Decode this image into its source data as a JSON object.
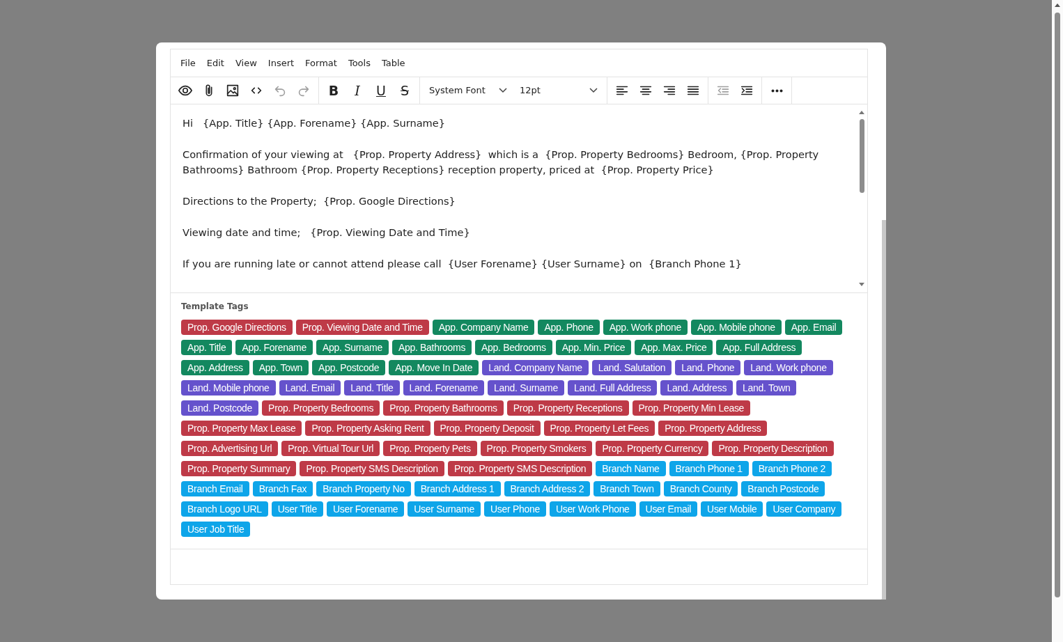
{
  "menu": [
    "File",
    "Edit",
    "View",
    "Insert",
    "Format",
    "Tools",
    "Table"
  ],
  "toolbar": [
    [
      {
        "kind": "preview",
        "disabled": false
      },
      {
        "kind": "attach",
        "disabled": false
      },
      {
        "kind": "image",
        "disabled": false
      },
      {
        "kind": "code",
        "disabled": false
      },
      {
        "kind": "undo",
        "disabled": true
      },
      {
        "kind": "redo",
        "disabled": true
      }
    ],
    [
      {
        "kind": "bold",
        "label": "B",
        "disabled": false
      },
      {
        "kind": "italic",
        "label": "I",
        "disabled": false
      },
      {
        "kind": "underline",
        "label": "U",
        "disabled": false
      },
      {
        "kind": "strike",
        "label": "S",
        "disabled": false
      }
    ],
    [
      {
        "kind": "select",
        "value": "System Font"
      },
      {
        "kind": "select",
        "value": "12pt"
      }
    ],
    [
      {
        "kind": "align-left",
        "disabled": false
      },
      {
        "kind": "align-center",
        "disabled": false
      },
      {
        "kind": "align-right",
        "disabled": false
      },
      {
        "kind": "justify",
        "disabled": false
      }
    ],
    [
      {
        "kind": "outdent",
        "disabled": true
      },
      {
        "kind": "indent",
        "disabled": false
      }
    ],
    [
      {
        "kind": "more",
        "disabled": false
      }
    ]
  ],
  "content": [
    "Hi   {App. Title} {App. Forename} {App. Surname}",
    "Confirmation of your viewing at   {Prop. Property Address}  which is a  {Prop. Property Bedrooms} Bedroom, {Prop. Property Bathrooms} Bathroom {Prop. Property Receptions} reception property, priced at  {Prop. Property Price}",
    "Directions to the Property;  {Prop. Google Directions}",
    "Viewing date and time;   {Prop. Viewing Date and Time}",
    "If you are running late or cannot attend please call  {User Forename} {User Surname} on  {Branch Phone 1}"
  ],
  "template_tags": {
    "title": "Template Tags",
    "tags": [
      {
        "label": "Prop. Google Directions",
        "color": "#be3a47"
      },
      {
        "label": "Prop. Viewing Date and Time",
        "color": "#be3a47"
      },
      {
        "label": "App. Company Name",
        "color": "#13885f"
      },
      {
        "label": "App. Phone",
        "color": "#13885f"
      },
      {
        "label": "App. Work phone",
        "color": "#13885f"
      },
      {
        "label": "App. Mobile phone",
        "color": "#13885f"
      },
      {
        "label": "App. Email",
        "color": "#13885f"
      },
      {
        "label": "App. Title",
        "color": "#13885f"
      },
      {
        "label": "App. Forename",
        "color": "#13885f"
      },
      {
        "label": "App. Surname",
        "color": "#13885f"
      },
      {
        "label": "App. Bathrooms",
        "color": "#13885f"
      },
      {
        "label": "App. Bedrooms",
        "color": "#13885f"
      },
      {
        "label": "App. Min. Price",
        "color": "#13885f"
      },
      {
        "label": "App. Max. Price",
        "color": "#13885f"
      },
      {
        "label": "App. Full Address",
        "color": "#13885f"
      },
      {
        "label": "App. Address",
        "color": "#13885f"
      },
      {
        "label": "App. Town",
        "color": "#13885f"
      },
      {
        "label": "App. Postcode",
        "color": "#13885f"
      },
      {
        "label": "App. Move In Date",
        "color": "#13885f"
      },
      {
        "label": "Land. Company Name",
        "color": "#6552cc"
      },
      {
        "label": "Land. Salutation",
        "color": "#6552cc"
      },
      {
        "label": "Land. Phone",
        "color": "#6552cc"
      },
      {
        "label": "Land. Work phone",
        "color": "#6552cc"
      },
      {
        "label": "Land. Mobile phone",
        "color": "#6552cc"
      },
      {
        "label": "Land. Email",
        "color": "#6552cc"
      },
      {
        "label": "Land. Title",
        "color": "#6552cc"
      },
      {
        "label": "Land. Forename",
        "color": "#6552cc"
      },
      {
        "label": "Land. Surname",
        "color": "#6552cc"
      },
      {
        "label": "Land. Full Address",
        "color": "#6552cc"
      },
      {
        "label": "Land. Address",
        "color": "#6552cc"
      },
      {
        "label": "Land. Town",
        "color": "#6552cc"
      },
      {
        "label": "Land. Postcode",
        "color": "#6552cc"
      },
      {
        "label": "Prop. Property Bedrooms",
        "color": "#be3a47"
      },
      {
        "label": "Prop. Property Bathrooms",
        "color": "#be3a47"
      },
      {
        "label": "Prop. Property Receptions",
        "color": "#be3a47"
      },
      {
        "label": "Prop. Property Min Lease",
        "color": "#be3a47"
      },
      {
        "label": "Prop. Property Max Lease",
        "color": "#be3a47"
      },
      {
        "label": "Prop. Property Asking Rent",
        "color": "#be3a47"
      },
      {
        "label": "Prop. Property Deposit",
        "color": "#be3a47"
      },
      {
        "label": "Prop. Property Let Fees",
        "color": "#be3a47"
      },
      {
        "label": "Prop. Property Address",
        "color": "#be3a47"
      },
      {
        "label": "Prop. Advertising Url",
        "color": "#be3a47"
      },
      {
        "label": "Prop. Virtual Tour Url",
        "color": "#be3a47"
      },
      {
        "label": "Prop. Property Pets",
        "color": "#be3a47"
      },
      {
        "label": "Prop. Property Smokers",
        "color": "#be3a47"
      },
      {
        "label": "Prop. Property Currency",
        "color": "#be3a47"
      },
      {
        "label": "Prop. Property Description",
        "color": "#be3a47"
      },
      {
        "label": "Prop. Property Summary",
        "color": "#be3a47"
      },
      {
        "label": "Prop. Property SMS Description",
        "color": "#be3a47"
      },
      {
        "label": "Prop. Property SMS Description",
        "color": "#be3a47"
      },
      {
        "label": "Branch Name",
        "color": "#0ea5e9"
      },
      {
        "label": "Branch Phone 1",
        "color": "#0ea5e9"
      },
      {
        "label": "Branch Phone 2",
        "color": "#0ea5e9"
      },
      {
        "label": "Branch Email",
        "color": "#0ea5e9"
      },
      {
        "label": "Branch Fax",
        "color": "#0ea5e9"
      },
      {
        "label": "Branch Property No",
        "color": "#0ea5e9"
      },
      {
        "label": "Branch Address 1",
        "color": "#0ea5e9"
      },
      {
        "label": "Branch Address 2",
        "color": "#0ea5e9"
      },
      {
        "label": "Branch Town",
        "color": "#0ea5e9"
      },
      {
        "label": "Branch County",
        "color": "#0ea5e9"
      },
      {
        "label": "Branch Postcode",
        "color": "#0ea5e9"
      },
      {
        "label": "Branch Logo URL",
        "color": "#0ea5e9"
      },
      {
        "label": "User Title",
        "color": "#0ea5e9"
      },
      {
        "label": "User Forename",
        "color": "#0ea5e9"
      },
      {
        "label": "User Surname",
        "color": "#0ea5e9"
      },
      {
        "label": "User Phone",
        "color": "#0ea5e9"
      },
      {
        "label": "User Work Phone",
        "color": "#0ea5e9"
      },
      {
        "label": "User Email",
        "color": "#0ea5e9"
      },
      {
        "label": "User Mobile",
        "color": "#0ea5e9"
      },
      {
        "label": "User Company",
        "color": "#0ea5e9"
      },
      {
        "label": "User Job Title",
        "color": "#0ea5e9"
      }
    ]
  }
}
